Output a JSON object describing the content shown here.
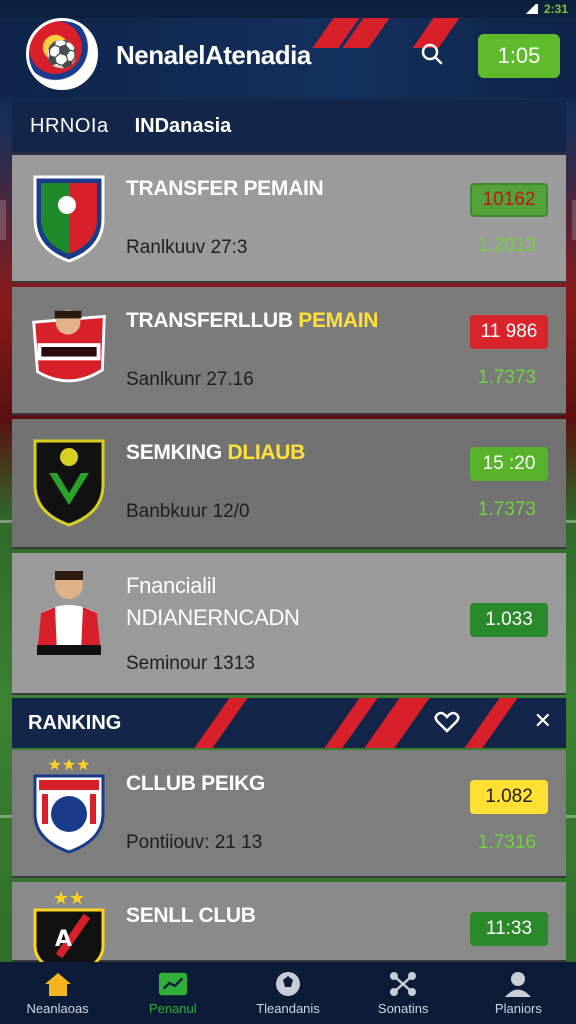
{
  "status_bar": {
    "battery": "2:31"
  },
  "header": {
    "title": "NenalelAtenadia",
    "time_button": "1:05"
  },
  "section": {
    "label_left": "HRNOIa",
    "label_right": "INDanasia"
  },
  "cards": [
    {
      "title": "TRANSFER PEMAIN",
      "title_highlight": "",
      "subtitle": "Ranlkuuv 27:3",
      "badge": "10162",
      "badge_style": "red-outline",
      "value": "1.2013"
    },
    {
      "title": "TRANSFERLLUB ",
      "title_highlight": "PEMAIN",
      "subtitle": "Sanlkunr 27.16",
      "badge": "11 986",
      "badge_style": "red",
      "value": "1.7373"
    },
    {
      "title": "SEMKING ",
      "title_highlight": "DLIAUB",
      "subtitle": "Banbkuur 12/0",
      "badge": "15 :20",
      "badge_style": "lime",
      "value": "1.7373"
    },
    {
      "title_line1": "Fnancialil",
      "title_line2": "NDIANERNCADN",
      "subtitle": "Seminour 1313",
      "badge": "1.033",
      "badge_style": "green"
    }
  ],
  "ranking": {
    "label": "RANKING"
  },
  "ranking_cards": [
    {
      "title": "CLLUB PEIKG",
      "subtitle": "Pontiiouv: 21 13",
      "badge": "1.082",
      "badge_style": "yellow",
      "value": "1.7316"
    },
    {
      "title": "SENLL CLUB",
      "badge": "11:33",
      "badge_style": "green"
    }
  ],
  "bottom_nav": [
    {
      "label": "Neanlaoas",
      "icon": "home-icon",
      "active": false
    },
    {
      "label": "Penanul",
      "icon": "chart-icon",
      "active": true
    },
    {
      "label": "Tleandanis",
      "icon": "ball-icon",
      "active": false
    },
    {
      "label": "Sonatins",
      "icon": "network-icon",
      "active": false
    },
    {
      "label": "Planiors",
      "icon": "person-icon",
      "active": false
    }
  ],
  "colors": {
    "header_bg": "#0e2448",
    "accent_red": "#d8202a",
    "accent_green": "#5dbb2c",
    "highlight_yellow": "#ffe03a",
    "card_bg": "#8d8d8d"
  }
}
